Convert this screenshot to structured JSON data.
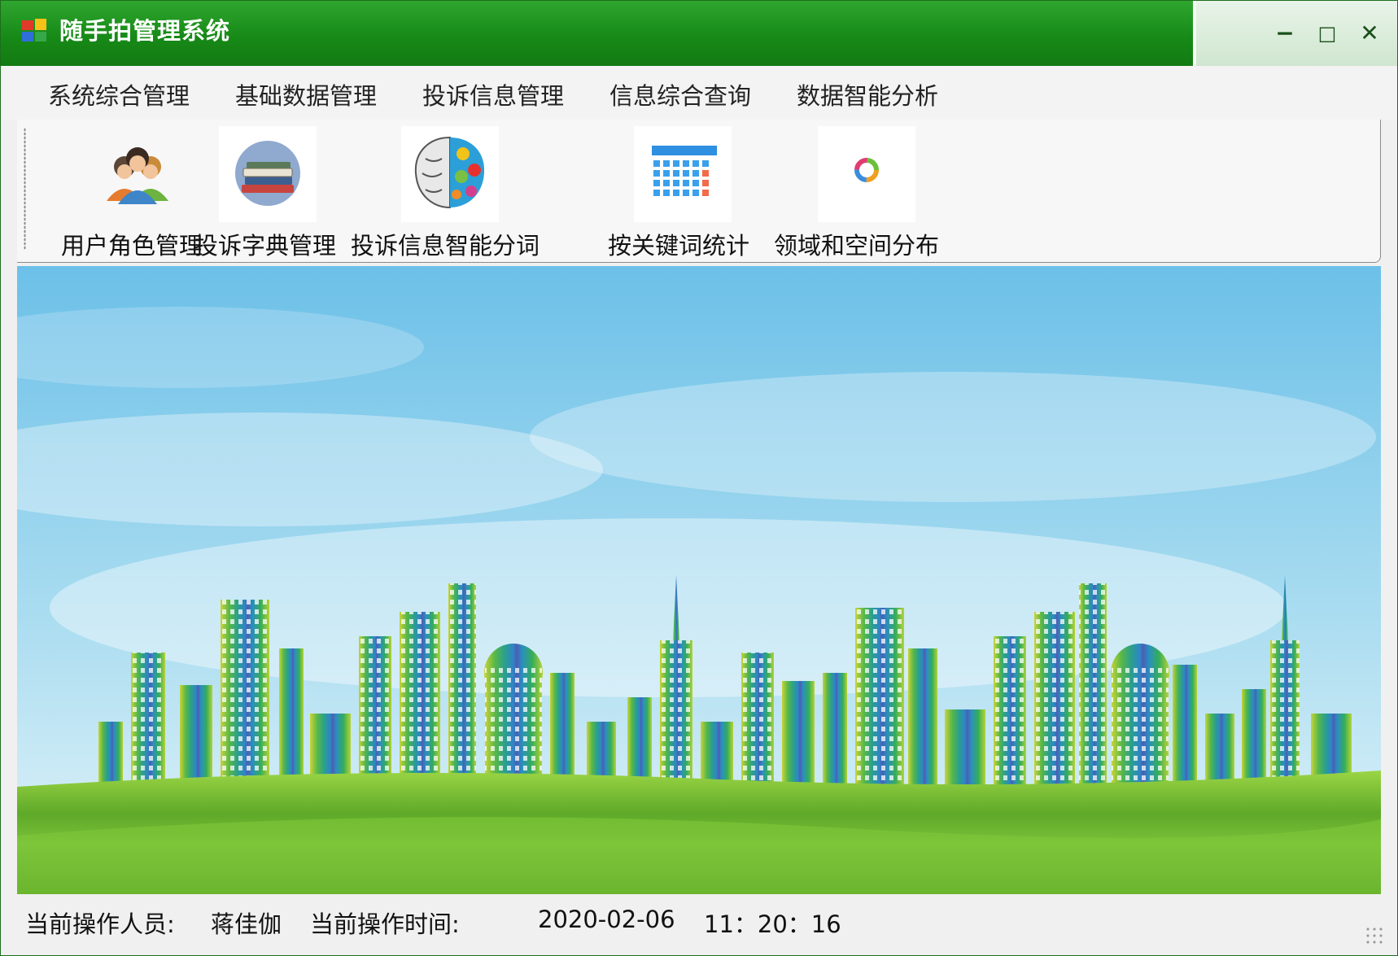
{
  "window": {
    "title": "随手拍管理系统",
    "controls": {
      "minimize": "−",
      "maximize": "□",
      "close": "✕"
    }
  },
  "menu": {
    "items": [
      {
        "label": "系统综合管理"
      },
      {
        "label": "基础数据管理"
      },
      {
        "label": "投诉信息管理"
      },
      {
        "label": "信息综合查询"
      },
      {
        "label": "数据智能分析"
      }
    ]
  },
  "toolbar": {
    "items": [
      {
        "label": "用户角色管理",
        "icon": "users-group-icon"
      },
      {
        "label": "投诉字典管理",
        "icon": "books-icon"
      },
      {
        "label": "投诉信息智能分词",
        "icon": "brain-icon"
      },
      {
        "label": "按关键词统计",
        "icon": "calendar-icon"
      },
      {
        "label": "领域和空间分布",
        "icon": "ring-chart-icon"
      }
    ]
  },
  "status": {
    "operator_label": "当前操作人员:",
    "operator_value": "蒋佳伽",
    "time_label": "当前操作时间:",
    "date_value": "2020-02-06",
    "time_value": "11：20：16"
  },
  "colors": {
    "titlebar_green": "#178a17",
    "sky": "#7cc6e6",
    "grass": "#6fbf2a"
  }
}
